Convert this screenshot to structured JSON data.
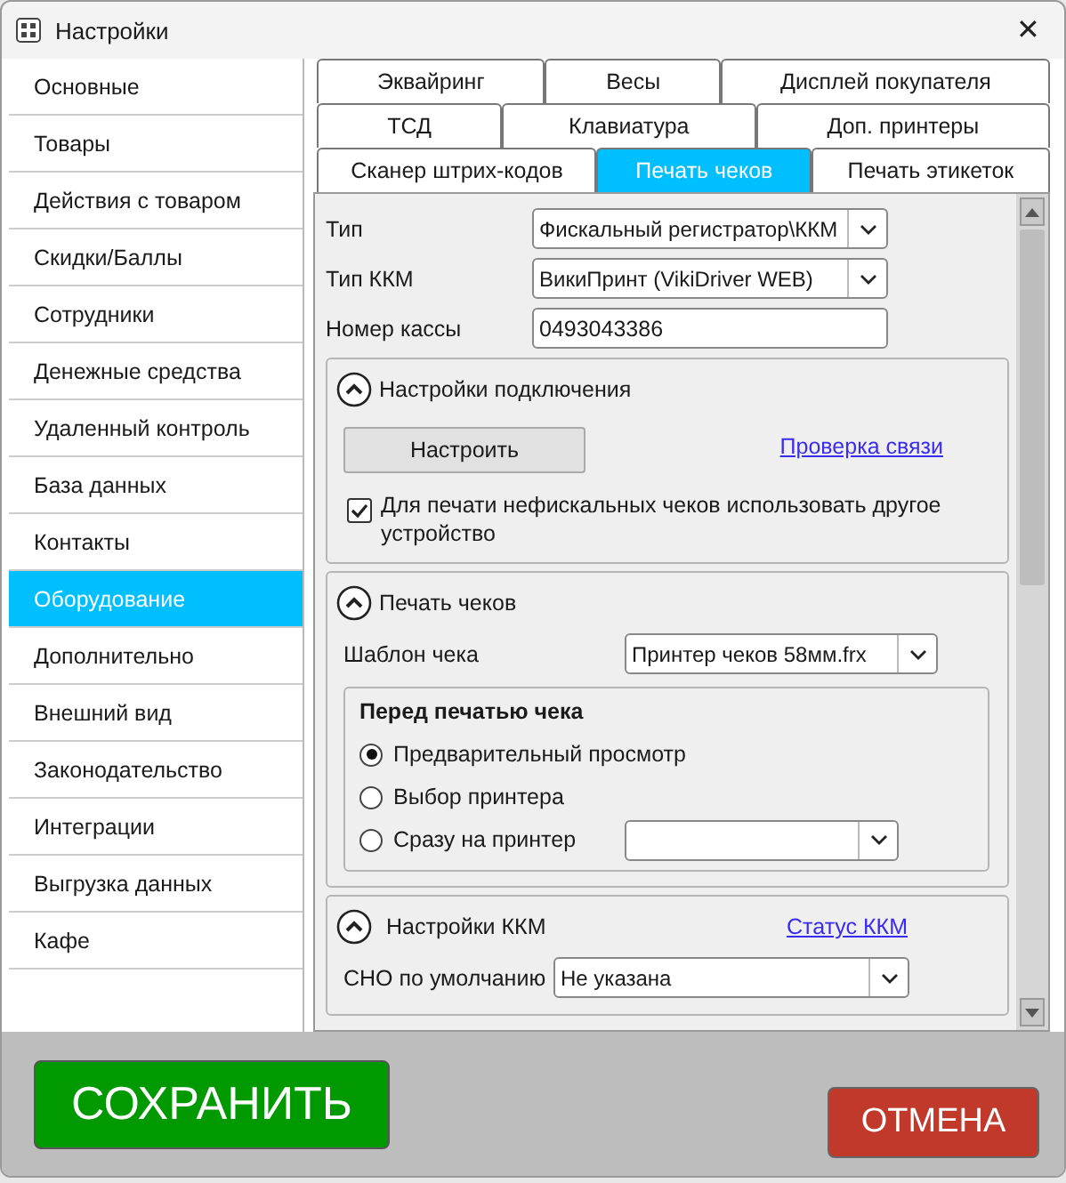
{
  "window": {
    "title": "Настройки",
    "close": "✕"
  },
  "sidebar": {
    "items": [
      {
        "label": "Основные",
        "selected": false
      },
      {
        "label": "Товары",
        "selected": false
      },
      {
        "label": "Действия с товаром",
        "selected": false
      },
      {
        "label": "Скидки/Баллы",
        "selected": false
      },
      {
        "label": "Сотрудники",
        "selected": false
      },
      {
        "label": "Денежные средства",
        "selected": false
      },
      {
        "label": "Удаленный контроль",
        "selected": false
      },
      {
        "label": "База данных",
        "selected": false
      },
      {
        "label": "Контакты",
        "selected": false
      },
      {
        "label": "Оборудование",
        "selected": true
      },
      {
        "label": "Дополнительно",
        "selected": false
      },
      {
        "label": "Внешний вид",
        "selected": false
      },
      {
        "label": "Законодательство",
        "selected": false
      },
      {
        "label": "Интеграции",
        "selected": false
      },
      {
        "label": "Выгрузка данных",
        "selected": false
      },
      {
        "label": "Кафе",
        "selected": false
      }
    ]
  },
  "tab_rows": [
    [
      {
        "label": "Эквайринг",
        "selected": false
      },
      {
        "label": "Весы",
        "selected": false
      },
      {
        "label": "Дисплей покупателя",
        "selected": false
      }
    ],
    [
      {
        "label": "ТСД",
        "selected": false
      },
      {
        "label": "Клавиатура",
        "selected": false
      },
      {
        "label": "Доп. принтеры",
        "selected": false
      }
    ],
    [
      {
        "label": "Сканер штрих-кодов",
        "selected": false
      },
      {
        "label": "Печать чеков",
        "selected": true
      },
      {
        "label": "Печать этикеток",
        "selected": false
      }
    ]
  ],
  "fields": [
    {
      "label": "Тип",
      "value": "Фискальный регистратор\\ККМ",
      "kind": "select"
    },
    {
      "label": "Тип ККМ",
      "value": "ВикиПринт (VikiDriver WEB)",
      "kind": "select"
    },
    {
      "label": "Номер кассы",
      "value": "0493043386",
      "kind": "text"
    }
  ],
  "connection": {
    "title": "Настройки подключения",
    "expanded": true,
    "button": "Настроить",
    "link": "Проверка связи",
    "checkbox": {
      "label": "Для печати нефискальных чеков использовать другое устройство",
      "checked": true
    }
  },
  "receipt_print": {
    "title": "Печать чеков",
    "expanded": true,
    "template": {
      "label": "Шаблон чека",
      "value": "Принтер чеков 58мм.frx"
    },
    "group_title": "Перед печатью чека",
    "options": [
      {
        "label": "Предварительный просмотр",
        "selected": true,
        "kind": "plain"
      },
      {
        "label": "Выбор принтера",
        "selected": false,
        "kind": "plain"
      },
      {
        "label": "Сразу на принтер",
        "selected": false,
        "kind": "with-select"
      }
    ]
  },
  "kkm": {
    "title": "Настройки ККМ",
    "expanded": true,
    "link": "Статус ККМ",
    "fields": [
      {
        "label": "СНО по умолчанию",
        "value": "Не указана"
      }
    ]
  },
  "buttons": {
    "save": "СОХРАНИТЬ",
    "cancel": "ОТМЕНА"
  }
}
